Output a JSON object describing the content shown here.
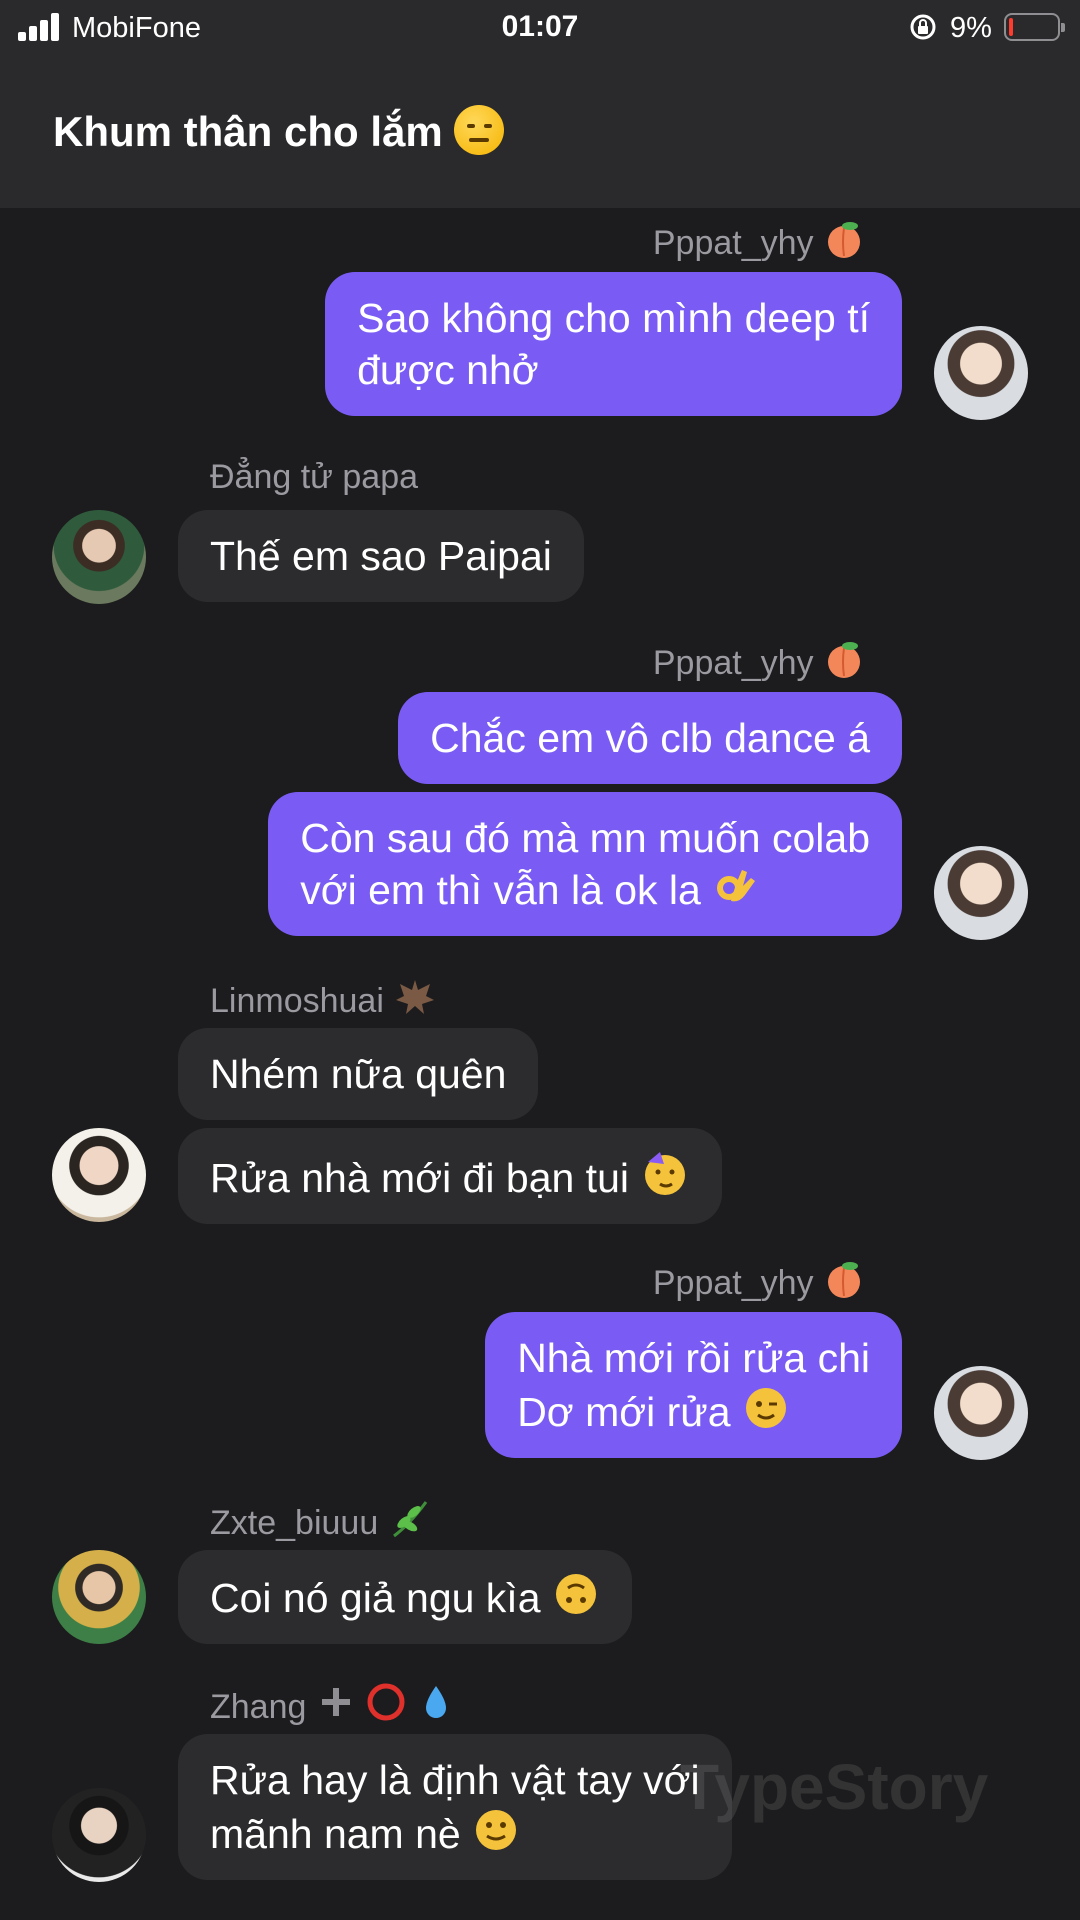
{
  "status_bar": {
    "carrier": "MobiFone",
    "time": "01:07",
    "battery_percent": "9%",
    "battery_level": 0.09,
    "battery_color": "#ff3b30"
  },
  "header": {
    "title": "Khum thân cho lắm",
    "title_emoji": "unamused-face-emoji"
  },
  "colors": {
    "background": "#1c1c1e",
    "header": "#2a2a2c",
    "outgoing_bubble": "#7a5cf5",
    "incoming_bubble": "#2c2c2e",
    "name_text": "#9a9aa0"
  },
  "messages": [
    {
      "sender": "Pppat_yhy",
      "sender_icon": "peach-emoji",
      "direction": "out",
      "lines": [
        "Sao không cho mình deep tí",
        "được nhở"
      ]
    },
    {
      "sender": "Đẳng tử papa",
      "direction": "in",
      "lines": [
        "Thế em sao Paipai"
      ]
    },
    {
      "sender": "Pppat_yhy",
      "sender_icon": "peach-emoji",
      "direction": "out",
      "lines": [
        "Chắc em vô clb dance á"
      ]
    },
    {
      "direction": "out",
      "lines": [
        "Còn sau đó mà mn muốn colab",
        "với em thì vẫn là ok la"
      ],
      "trailing_emoji": "ok-hand-emoji"
    },
    {
      "sender": "Linmoshuai",
      "sender_icon": "bat-emoji",
      "direction": "in",
      "lines": [
        "Nhém nữa quên"
      ]
    },
    {
      "direction": "in",
      "lines": [
        "Rửa nhà mới đi bạn tui"
      ],
      "trailing_emoji": "partying-face-emoji"
    },
    {
      "sender": "Pppat_yhy",
      "sender_icon": "peach-emoji",
      "direction": "out",
      "lines": [
        "Nhà mới rồi rửa chi",
        "Dơ mới rửa"
      ],
      "trailing_emoji": "winking-face-emoji"
    },
    {
      "sender": "Zxte_biuuu",
      "sender_icon": "herb-emoji",
      "direction": "in",
      "lines": [
        "Coi nó giả ngu kìa"
      ],
      "trailing_emoji": "upside-down-face-emoji"
    },
    {
      "sender": "Zhang",
      "sender_icon": "plus-circle-droplet-emoji",
      "direction": "in",
      "lines": [
        "Rửa hay là định vật tay với",
        "mãnh nam nè"
      ],
      "trailing_emoji": "slightly-smiling-face-emoji"
    }
  ],
  "watermark": "TypeStory"
}
